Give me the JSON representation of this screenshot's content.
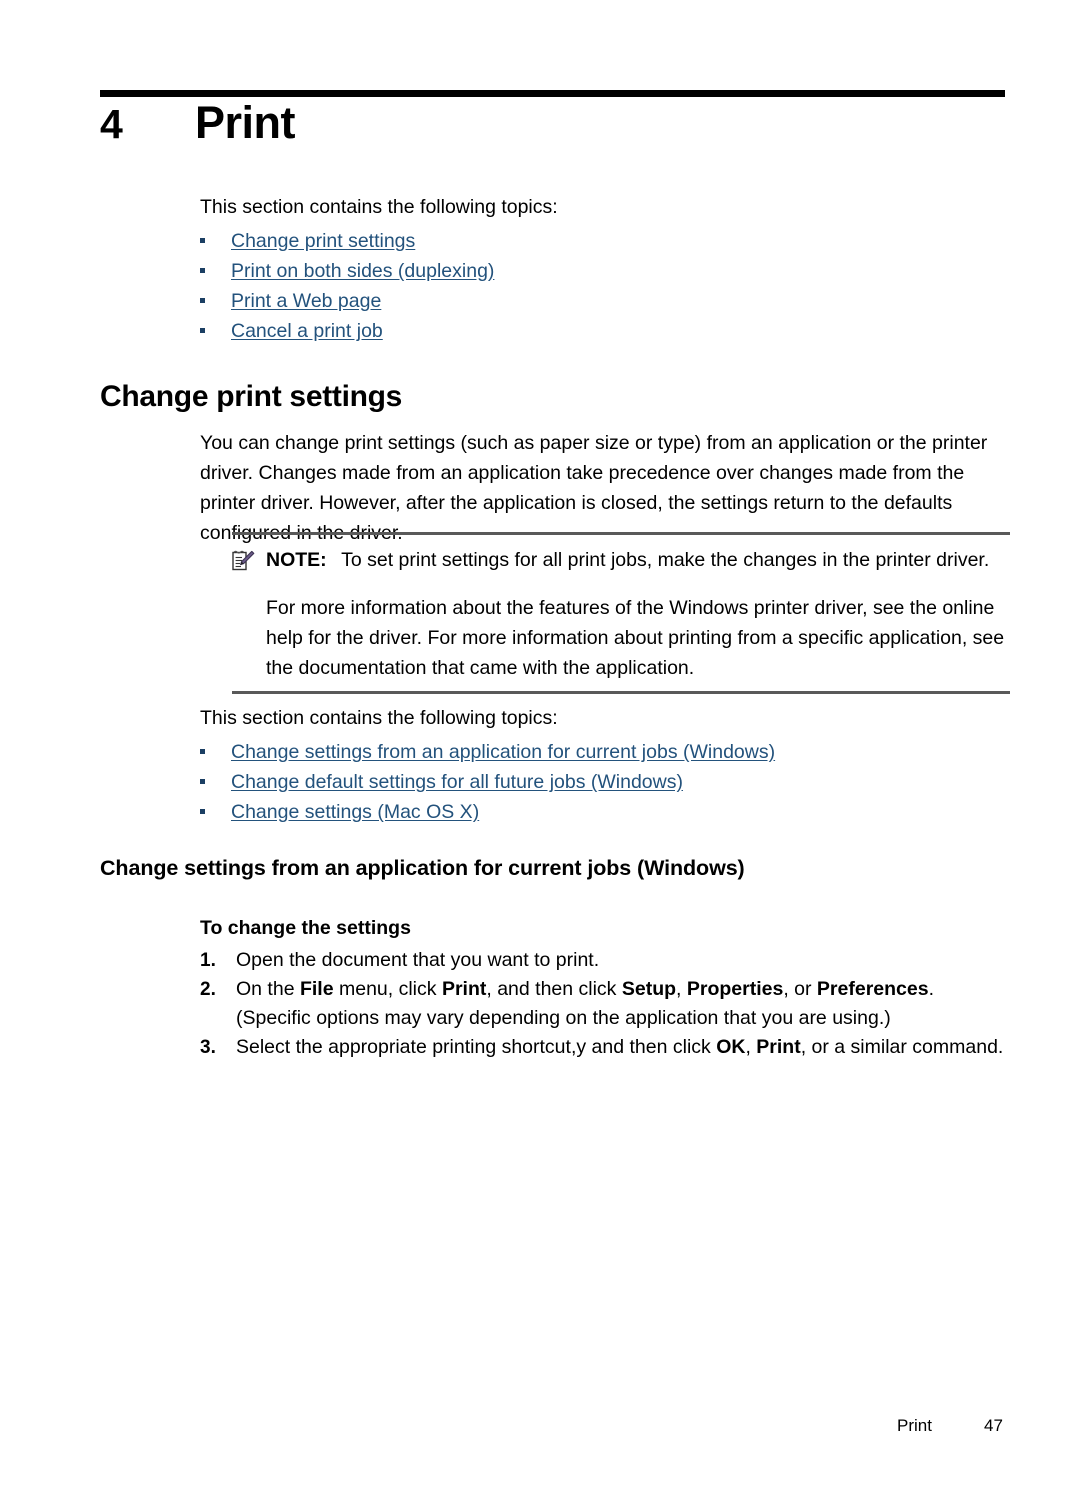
{
  "chapter": {
    "number": "4",
    "title": "Print"
  },
  "intro": {
    "text": "This section contains the following topics:"
  },
  "chapter_toc": [
    {
      "label": "Change print settings"
    },
    {
      "label": "Print on both sides (duplexing)"
    },
    {
      "label": "Print a Web page"
    },
    {
      "label": "Cancel a print job"
    }
  ],
  "section": {
    "heading": "Change print settings",
    "paragraph": "You can change print settings (such as paper size or type) from an application or the printer driver. Changes made from an application take precedence over changes made from the printer driver. However, after the application is closed, the settings return to the defaults configured in the driver."
  },
  "note": {
    "icon": "note-pencil-icon",
    "label": "NOTE:",
    "text": "To set print settings for all print jobs, make the changes in the printer driver.",
    "paragraph": "For more information about the features of the Windows printer driver, see the online help for the driver. For more information about printing from a specific application, see the documentation that came with the application."
  },
  "intro2": {
    "text": "This section contains the following topics:"
  },
  "section_toc": [
    {
      "label": "Change settings from an application for current jobs (Windows)"
    },
    {
      "label": "Change default settings for all future jobs (Windows)"
    },
    {
      "label": "Change settings (Mac OS X)"
    }
  ],
  "subsection": {
    "heading": "Change settings from an application for current jobs (Windows)",
    "procedure_title": "To change the settings"
  },
  "steps": [
    {
      "num": "1.",
      "parts": [
        {
          "t": "Open the document that you want to print.",
          "b": false
        }
      ]
    },
    {
      "num": "2.",
      "parts": [
        {
          "t": "On the ",
          "b": false
        },
        {
          "t": "File",
          "b": true
        },
        {
          "t": " menu, click ",
          "b": false
        },
        {
          "t": "Print",
          "b": true
        },
        {
          "t": ", and then click ",
          "b": false
        },
        {
          "t": "Setup",
          "b": true
        },
        {
          "t": ", ",
          "b": false
        },
        {
          "t": "Properties",
          "b": true
        },
        {
          "t": ", or ",
          "b": false
        },
        {
          "t": "Preferences",
          "b": true
        },
        {
          "t": ". (Specific options may vary depending on the application that you are using.)",
          "b": false
        }
      ]
    },
    {
      "num": "3.",
      "parts": [
        {
          "t": "Select the appropriate printing shortcut,y and then click ",
          "b": false
        },
        {
          "t": "OK",
          "b": true
        },
        {
          "t": ", ",
          "b": false
        },
        {
          "t": "Print",
          "b": true
        },
        {
          "t": ", or a similar command.",
          "b": false
        }
      ]
    }
  ],
  "footer": {
    "label": "Print",
    "page": "47"
  },
  "colors": {
    "link": "#23527c",
    "bullet": "#1b3f63",
    "rule_black": "#000000",
    "rule_gray": "#595959"
  }
}
